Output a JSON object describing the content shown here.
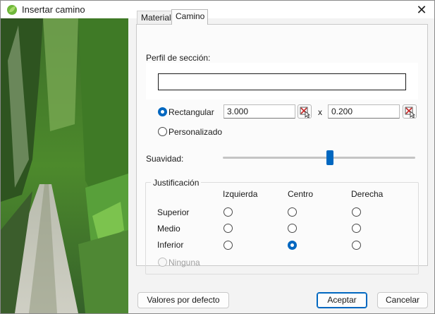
{
  "window": {
    "title": "Insertar camino",
    "icon": "leaf-icon"
  },
  "tabs": [
    {
      "label": "Material",
      "selected": false
    },
    {
      "label": "Camino",
      "selected": true
    }
  ],
  "camino": {
    "profile_label": "Perfil de sección:",
    "profile_value": "",
    "shape": {
      "rectangular_label": "Rectangular",
      "rectangular_selected": true,
      "width_value": "3.000",
      "separator": "x",
      "height_value": "0.200",
      "custom_label": "Personalizado",
      "custom_selected": false
    },
    "smoothness": {
      "label": "Suavidad:",
      "value_fraction": 0.53
    },
    "justification": {
      "title": "Justificación",
      "columns": [
        "Izquierda",
        "Centro",
        "Derecha"
      ],
      "rows": [
        "Superior",
        "Medio",
        "Inferior"
      ],
      "selected": {
        "row": "Inferior",
        "column": "Centro"
      },
      "none_label": "Ninguna",
      "none_enabled": false
    }
  },
  "buttons": {
    "defaults": "Valores por defecto",
    "accept": "Aceptar",
    "cancel": "Cancelar"
  },
  "colors": {
    "accent": "#0067c0",
    "pick_icon": "#c62828"
  }
}
